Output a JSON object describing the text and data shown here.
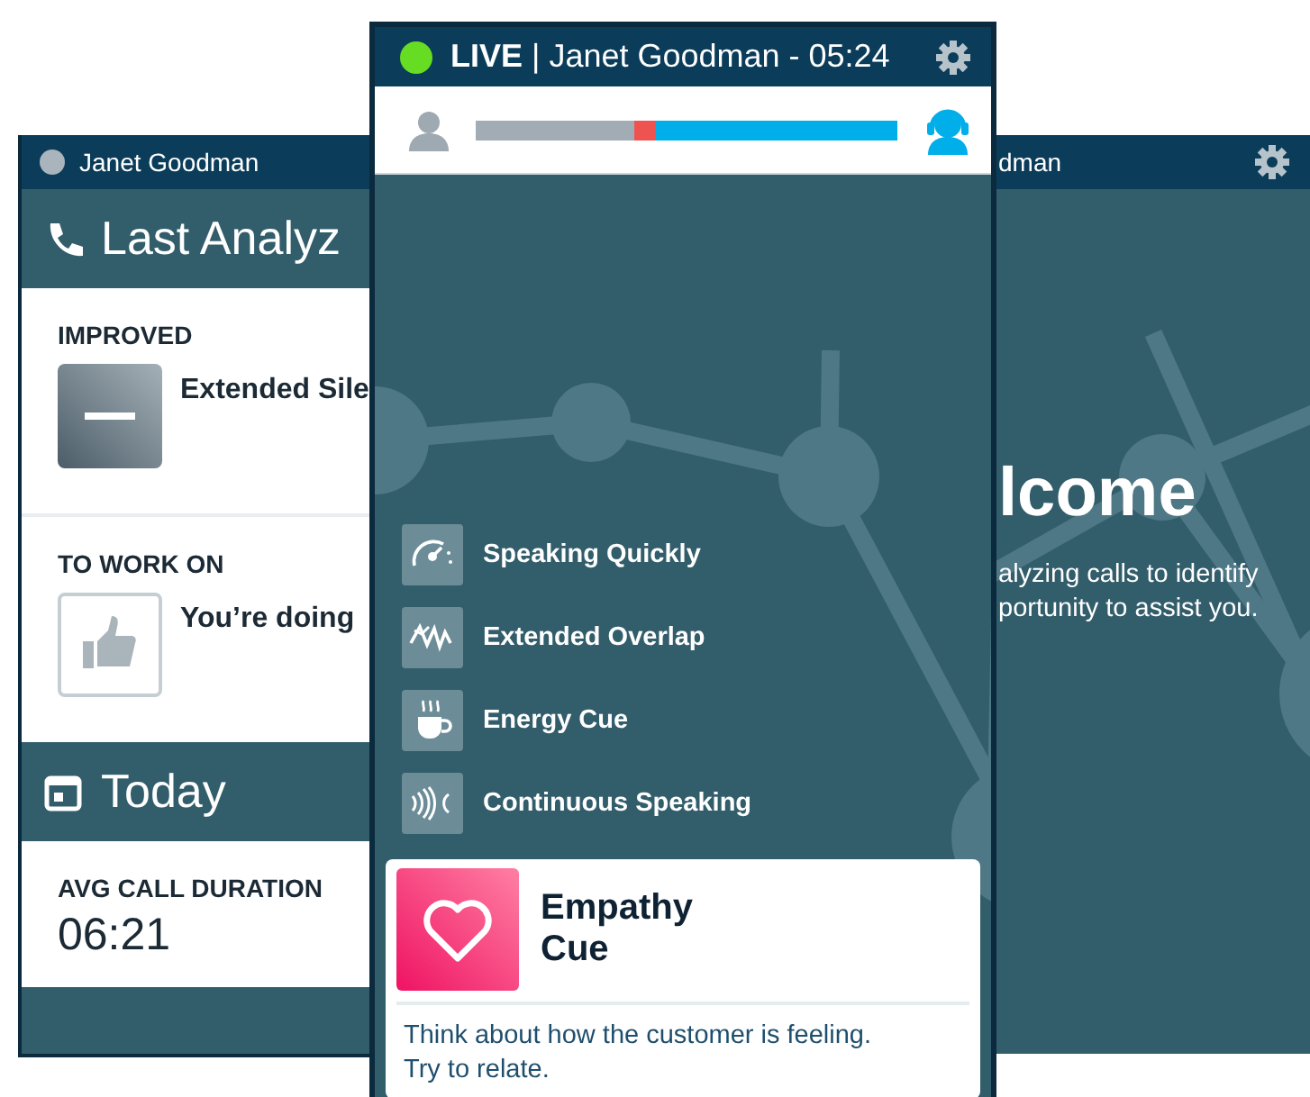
{
  "left_screen": {
    "user_name": "Janet Goodman",
    "section_title": "Last Analyz",
    "improved": {
      "label": "IMPROVED",
      "item": "Extended Sile"
    },
    "to_work_on": {
      "label": "TO WORK ON",
      "item": "You’re doing"
    },
    "today_title": "Today",
    "stat": {
      "label": "AVG CALL DURATION",
      "value": "06:21"
    }
  },
  "live_screen": {
    "header": "**LIVE** | Janet Goodman - 05:24",
    "talk_bar": {
      "level": 0.375
    },
    "cues": [
      {
        "kind": "speed",
        "label": "Speaking Quickly"
      },
      {
        "kind": "overlap",
        "label": "Extended Overlap"
      },
      {
        "kind": "energy",
        "label": "Energy Cue"
      },
      {
        "kind": "continuous",
        "label": "Continuous Speaking"
      }
    ],
    "alert": {
      "kind": "empathy",
      "title": "Empathy\nCue",
      "message": "Think about how the customer is feeling.\nTry to relate."
    }
  },
  "right_screen": {
    "user_name": "dman",
    "heading": "lcome",
    "message": "alyzing calls to identify\nportunity to assist you."
  }
}
